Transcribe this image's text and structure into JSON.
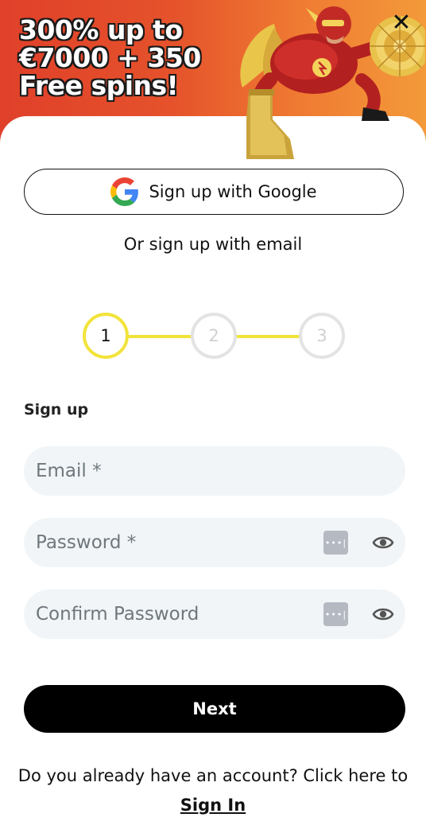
{
  "banner": {
    "promo_lines": [
      "300% up to",
      "€7000 + 350",
      "Free spins!"
    ],
    "close_icon": "close-icon"
  },
  "google": {
    "label": "Sign up with Google",
    "icon": "google-icon"
  },
  "divider_text": "Or sign up with email",
  "stepper": {
    "steps": [
      "1",
      "2",
      "3"
    ],
    "active_step": 1,
    "active_color": "#f2e33a",
    "inactive_color": "#e3e3e3"
  },
  "form": {
    "title": "Sign up",
    "email": {
      "placeholder": "Email *",
      "value": ""
    },
    "password": {
      "placeholder": "Password *",
      "value": "",
      "manager_icon": "password-manager-icon",
      "toggle_icon": "eye-icon"
    },
    "confirm": {
      "placeholder": "Confirm Password",
      "value": "",
      "manager_icon": "password-manager-icon",
      "toggle_icon": "eye-icon"
    },
    "pw_manager_glyph": "•••|"
  },
  "next_label": "Next",
  "footer": {
    "text": "Do you already have an account? Click here to",
    "link": "Sign In"
  },
  "colors": {
    "banner_start": "#e0402a",
    "banner_end": "#f39a3a",
    "field_bg": "#f1f5f8",
    "button_bg": "#000000"
  }
}
